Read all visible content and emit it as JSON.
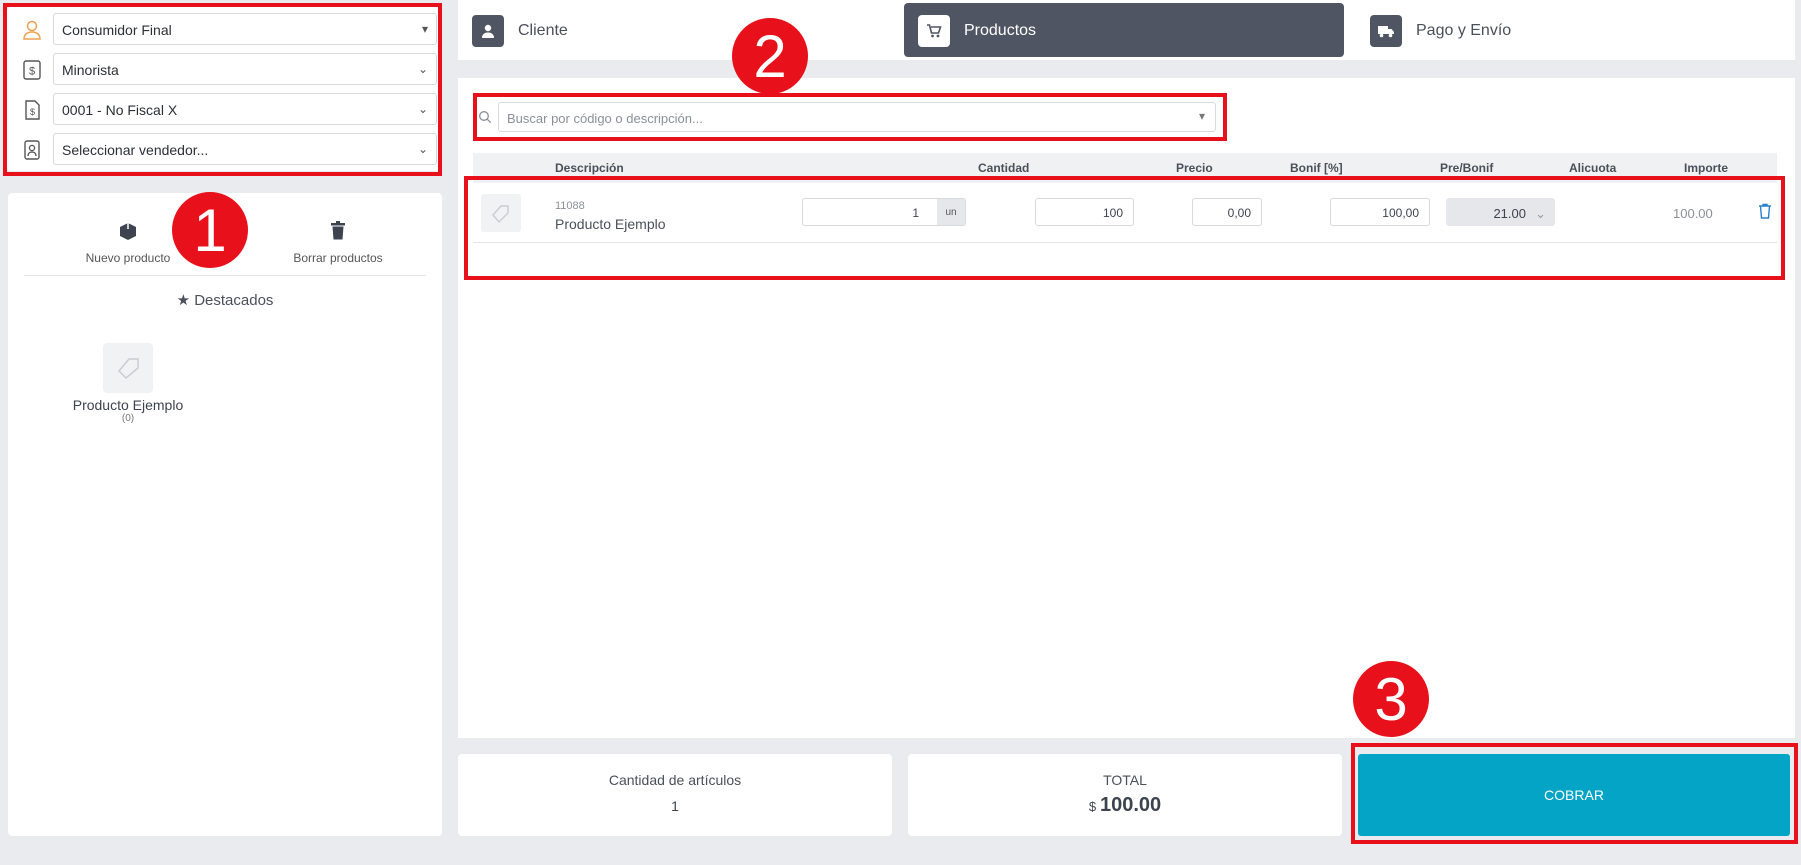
{
  "left": {
    "selects": [
      {
        "value": "Consumidor Final",
        "icon": "user-icon"
      },
      {
        "value": "Minorista",
        "icon": "price-list-icon"
      },
      {
        "value": "0001 - No Fiscal X",
        "icon": "invoice-icon"
      },
      {
        "value": "Seleccionar vendedor...",
        "icon": "seller-badge-icon"
      }
    ],
    "tools": {
      "new_product": "Nuevo producto",
      "delete_products": "Borrar productos"
    },
    "featured_title": "Destacados",
    "featured_item": {
      "name": "Producto Ejemplo",
      "count": "(0)"
    }
  },
  "tabs": [
    {
      "label": "Cliente",
      "icon": "user-icon"
    },
    {
      "label": "Productos",
      "icon": "cart-icon",
      "active": true
    },
    {
      "label": "Pago y Envío",
      "icon": "truck-icon"
    }
  ],
  "search": {
    "placeholder": "Buscar por código o descripción..."
  },
  "table": {
    "headers": [
      "Descripción",
      "Cantidad",
      "Precio",
      "Bonif [%]",
      "Pre/Bonif",
      "Alicuota",
      "Importe"
    ],
    "rows": [
      {
        "code": "11088",
        "name": "Producto Ejemplo",
        "quantity": "1",
        "unit": "un",
        "price": "100",
        "bonif": "0,00",
        "pre_bonif": "100,00",
        "alicuota": "21.00",
        "importe": "100.00"
      }
    ]
  },
  "summary": {
    "items_label": "Cantidad de artículos",
    "items_value": "1",
    "total_label": "TOTAL",
    "currency": "$",
    "total_value": "100.00",
    "charge_label": "COBRAR"
  },
  "annotations": [
    "1",
    "2",
    "3"
  ],
  "colors": {
    "accent": "#04a4c6",
    "active_tab": "#4f5563",
    "annotation": "#e8101a"
  }
}
